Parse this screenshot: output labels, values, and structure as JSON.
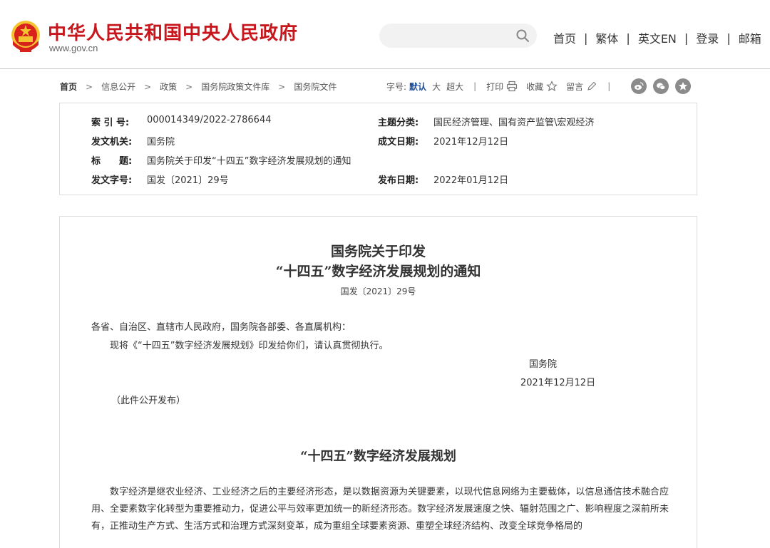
{
  "header": {
    "site_title": "中华人民共和国中央人民政府",
    "site_url": "www.gov.cn",
    "search_placeholder": "",
    "nav": [
      "首页",
      "繁体",
      "英文EN",
      "登录",
      "邮箱"
    ],
    "nav_separator": "|",
    "brand_color": "#c8161d"
  },
  "breadcrumb": {
    "items": [
      "首页",
      "信息公开",
      "政策",
      "国务院政策文件库",
      "国务院文件"
    ],
    "arrow": ">"
  },
  "tools": {
    "font_label": "字号:",
    "font_default": "默认",
    "font_large": "大",
    "font_xlarge": "超大",
    "separator": "|",
    "print_label": "打印",
    "favorite_label": "收藏",
    "comment_label": "留言",
    "share_icons": [
      "weibo-icon",
      "wechat-icon",
      "star-icon"
    ]
  },
  "info": {
    "index_no": {
      "label": "索 引 号:",
      "value": "000014349/2022-2786644"
    },
    "category": {
      "label": "主题分类:",
      "value": "国民经济管理、国有资产监管\\宏观经济"
    },
    "issuer": {
      "label": "发文机关:",
      "value": "国务院"
    },
    "written_date": {
      "label": "成文日期:",
      "value": "2021年12月12日"
    },
    "title": {
      "label": "标　　题:",
      "value": "国务院关于印发“十四五”数字经济发展规划的通知"
    },
    "doc_no": {
      "label": "发文字号:",
      "value": "国发〔2021〕29号"
    },
    "publish_date": {
      "label": "发布日期:",
      "value": "2022年01月12日"
    }
  },
  "article": {
    "title_line1": "国务院关于印发",
    "title_line2": "“十四五”数字经济发展规划的通知",
    "doc_no": "国发〔2021〕29号",
    "salutation": "各省、自治区、直辖市人民政府，国务院各部委、各直属机构：",
    "notice": "现将《“十四五”数字经济发展规划》印发给你们，请认真贯彻执行。",
    "signer": "国务院",
    "sign_date": "2021年12月12日",
    "public_note": "（此件公开发布）",
    "plan_title": "“十四五”数字经济发展规划",
    "body": "数字经济是继农业经济、工业经济之后的主要经济形态，是以数据资源为关键要素，以现代信息网络为主要载体，以信息通信技术融合应用、全要素数字化转型为重要推动力，促进公平与效率更加统一的新经济形态。数字经济发展速度之快、辐射范围之广、影响程度之深前所未有，正推动生产方式、生活方式和治理方式深刻变革，成为重组全球要素资源、重塑全球经济结构、改变全球竞争格局的"
  }
}
